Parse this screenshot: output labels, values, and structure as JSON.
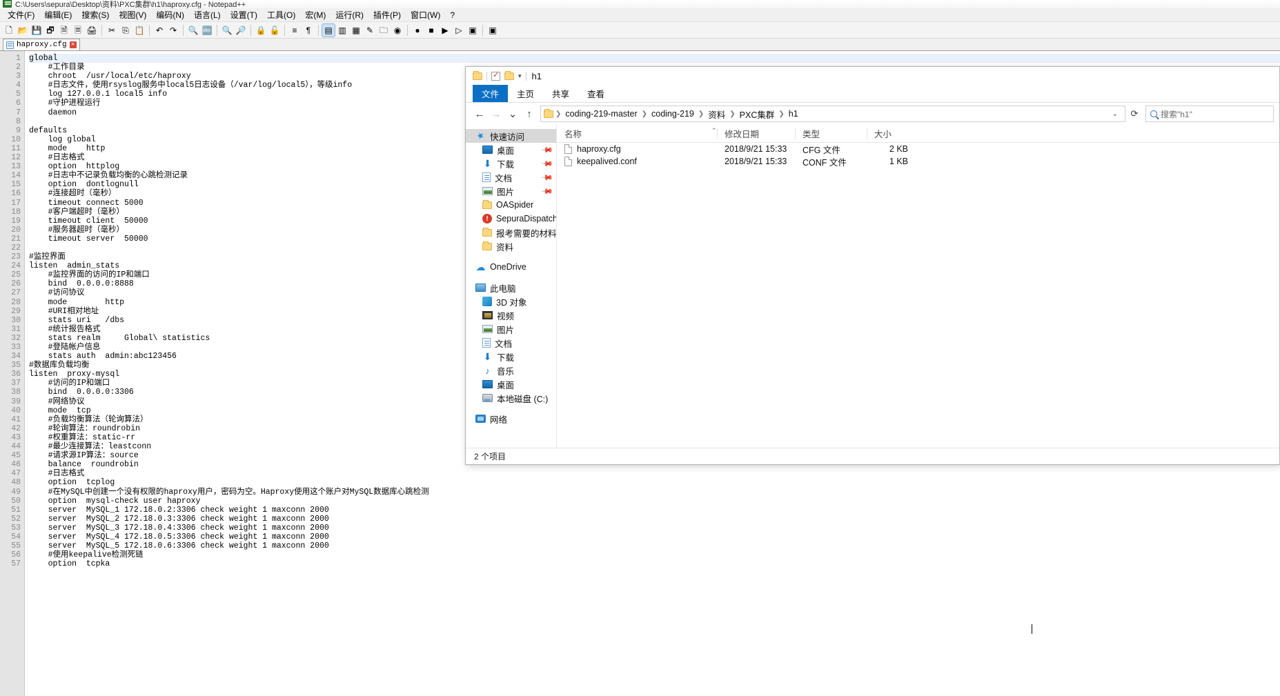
{
  "notepad": {
    "window_title": "C:\\Users\\sepura\\Desktop\\资料\\PXC集群\\h1\\haproxy.cfg - Notepad++",
    "menu": [
      "文件(F)",
      "编辑(E)",
      "搜索(S)",
      "视图(V)",
      "编码(N)",
      "语言(L)",
      "设置(T)",
      "工具(O)",
      "宏(M)",
      "运行(R)",
      "插件(P)",
      "窗口(W)",
      "?"
    ],
    "toolbar": [
      {
        "name": "new-file-icon",
        "glyph": "🗋"
      },
      {
        "name": "open-file-icon",
        "glyph": "📂"
      },
      {
        "name": "save-icon",
        "glyph": "💾"
      },
      {
        "name": "save-all-icon",
        "glyph": "🗗"
      },
      {
        "name": "close-file-icon",
        "glyph": "🗎"
      },
      {
        "name": "close-all-icon",
        "glyph": "🗏"
      },
      {
        "name": "print-icon",
        "glyph": "🖨"
      },
      {
        "name": "separator",
        "glyph": ""
      },
      {
        "name": "cut-icon",
        "glyph": "✂"
      },
      {
        "name": "copy-icon",
        "glyph": "⎘"
      },
      {
        "name": "paste-icon",
        "glyph": "📋"
      },
      {
        "name": "separator",
        "glyph": ""
      },
      {
        "name": "undo-icon",
        "glyph": "↶"
      },
      {
        "name": "redo-icon",
        "glyph": "↷"
      },
      {
        "name": "separator",
        "glyph": ""
      },
      {
        "name": "find-icon",
        "glyph": "🔍"
      },
      {
        "name": "replace-icon",
        "glyph": "🔤"
      },
      {
        "name": "separator",
        "glyph": ""
      },
      {
        "name": "zoom-in-icon",
        "glyph": "🔍"
      },
      {
        "name": "zoom-out-icon",
        "glyph": "🔎"
      },
      {
        "name": "separator",
        "glyph": ""
      },
      {
        "name": "sync-v-scroll-icon",
        "glyph": "🔒"
      },
      {
        "name": "sync-h-scroll-icon",
        "glyph": "🔓"
      },
      {
        "name": "separator",
        "glyph": ""
      },
      {
        "name": "word-wrap-icon",
        "glyph": "≡"
      },
      {
        "name": "show-all-chars-icon",
        "glyph": "¶"
      },
      {
        "name": "separator",
        "glyph": ""
      },
      {
        "name": "indent-guide-icon",
        "glyph": "▤"
      },
      {
        "name": "user-defined-dialog-icon",
        "glyph": "▥"
      },
      {
        "name": "doc-map-icon",
        "glyph": "▦"
      },
      {
        "name": "function-list-icon",
        "glyph": "✎"
      },
      {
        "name": "folder-workspace-icon",
        "glyph": "🗀"
      },
      {
        "name": "monitor-icon",
        "glyph": "◉"
      },
      {
        "name": "separator",
        "glyph": ""
      },
      {
        "name": "record-macro-icon",
        "glyph": "●"
      },
      {
        "name": "stop-macro-icon",
        "glyph": "■"
      },
      {
        "name": "playback-macro-icon",
        "glyph": "▶"
      },
      {
        "name": "run-macro-multiple-icon",
        "glyph": "▷"
      },
      {
        "name": "save-macro-icon",
        "glyph": "▣"
      },
      {
        "name": "separator",
        "glyph": ""
      },
      {
        "name": "run-icon",
        "glyph": "▣"
      }
    ],
    "tab": {
      "label": "haproxy.cfg",
      "close": "✕"
    },
    "code_lines": [
      "global",
      "    #工作目录",
      "    chroot  /usr/local/etc/haproxy",
      "    #日志文件，使用rsyslog服务中local5日志设备（/var/log/local5），等级info",
      "    log 127.0.0.1 local5 info",
      "    #守护进程运行",
      "    daemon",
      "",
      "defaults",
      "    log global",
      "    mode    http",
      "    #日志格式",
      "    option  httplog",
      "    #日志中不记录负载均衡的心跳检测记录",
      "    option  dontlognull",
      "    #连接超时（毫秒）",
      "    timeout connect 5000",
      "    #客户端超时（毫秒）",
      "    timeout client  50000",
      "    #服务器超时（毫秒）",
      "    timeout server  50000",
      "",
      "#监控界面",
      "listen  admin_stats",
      "    #监控界面的访问的IP和端口",
      "    bind  0.0.0.0:8888",
      "    #访问协议",
      "    mode        http",
      "    #URI相对地址",
      "    stats uri   /dbs",
      "    #统计报告格式",
      "    stats realm     Global\\ statistics",
      "    #登陆帐户信息",
      "    stats auth  admin:abc123456",
      "#数据库负载均衡",
      "listen  proxy-mysql",
      "    #访问的IP和端口",
      "    bind  0.0.0.0:3306",
      "    #网络协议",
      "    mode  tcp",
      "    #负载均衡算法（轮询算法）",
      "    #轮询算法：roundrobin",
      "    #权重算法：static-rr",
      "    #最少连接算法：leastconn",
      "    #请求源IP算法：source",
      "    balance  roundrobin",
      "    #日志格式",
      "    option  tcplog",
      "    #在MySQL中创建一个没有权限的haproxy用户，密码为空。Haproxy使用这个账户对MySQL数据库心跳检测",
      "    option  mysql-check user haproxy",
      "    server  MySQL_1 172.18.0.2:3306 check weight 1 maxconn 2000",
      "    server  MySQL_2 172.18.0.3:3306 check weight 1 maxconn 2000",
      "    server  MySQL_3 172.18.0.4:3306 check weight 1 maxconn 2000",
      "    server  MySQL_4 172.18.0.5:3306 check weight 1 maxconn 2000",
      "    server  MySQL_5 172.18.0.6:3306 check weight 1 maxconn 2000",
      "    #使用keepalive检测死链",
      "    option  tcpka"
    ]
  },
  "explorer": {
    "title": "h1",
    "ribbon_tabs": [
      "文件",
      "主页",
      "共享",
      "查看"
    ],
    "nav_buttons": {
      "back": "←",
      "forward": "→",
      "recent": "⌄",
      "up": "↑"
    },
    "breadcrumbs": [
      "coding-219-master",
      "coding-219",
      "资料",
      "PXC集群",
      "h1"
    ],
    "address_caret": "⌄",
    "refresh": "⟳",
    "search_placeholder": "搜索\"h1\"",
    "sidebar": [
      {
        "label": "快速访问",
        "icon": "quick-access-icon",
        "selected": true,
        "indent": 0,
        "pin": false
      },
      {
        "label": "桌面",
        "icon": "desktop-icon",
        "selected": false,
        "indent": 1,
        "pin": true
      },
      {
        "label": "下载",
        "icon": "downloads-icon",
        "selected": false,
        "indent": 1,
        "pin": true
      },
      {
        "label": "文档",
        "icon": "documents-icon",
        "selected": false,
        "indent": 1,
        "pin": true
      },
      {
        "label": "图片",
        "icon": "pictures-icon",
        "selected": false,
        "indent": 1,
        "pin": true
      },
      {
        "label": "OASpider",
        "icon": "folder-icon",
        "selected": false,
        "indent": 1,
        "pin": false
      },
      {
        "label": "SepuraDispatchPr",
        "icon": "app-icon",
        "selected": false,
        "indent": 1,
        "pin": false
      },
      {
        "label": "报考需要的材料",
        "icon": "folder-icon",
        "selected": false,
        "indent": 1,
        "pin": false
      },
      {
        "label": "资料",
        "icon": "folder-icon",
        "selected": false,
        "indent": 1,
        "pin": false
      },
      {
        "label": "OneDrive",
        "icon": "onedrive-icon",
        "selected": false,
        "indent": 0,
        "pin": false,
        "gap_before": true
      },
      {
        "label": "此电脑",
        "icon": "this-pc-icon",
        "selected": false,
        "indent": 0,
        "pin": false,
        "gap_before": true
      },
      {
        "label": "3D 对象",
        "icon": "3d-objects-icon",
        "selected": false,
        "indent": 1,
        "pin": false
      },
      {
        "label": "视频",
        "icon": "videos-icon",
        "selected": false,
        "indent": 1,
        "pin": false
      },
      {
        "label": "图片",
        "icon": "pictures-icon",
        "selected": false,
        "indent": 1,
        "pin": false
      },
      {
        "label": "文档",
        "icon": "documents-icon",
        "selected": false,
        "indent": 1,
        "pin": false
      },
      {
        "label": "下载",
        "icon": "downloads-icon",
        "selected": false,
        "indent": 1,
        "pin": false
      },
      {
        "label": "音乐",
        "icon": "music-icon",
        "selected": false,
        "indent": 1,
        "pin": false
      },
      {
        "label": "桌面",
        "icon": "desktop-icon",
        "selected": false,
        "indent": 1,
        "pin": false
      },
      {
        "label": "本地磁盘 (C:)",
        "icon": "local-disk-icon",
        "selected": false,
        "indent": 1,
        "pin": false
      },
      {
        "label": "网络",
        "icon": "network-icon",
        "selected": false,
        "indent": 0,
        "pin": false,
        "gap_before": true
      }
    ],
    "columns": [
      "名称",
      "修改日期",
      "类型",
      "大小"
    ],
    "files": [
      {
        "name": "haproxy.cfg",
        "date": "2018/9/21 15:33",
        "type": "CFG 文件",
        "size": "2 KB"
      },
      {
        "name": "keepalived.conf",
        "date": "2018/9/21 15:33",
        "type": "CONF 文件",
        "size": "1 KB"
      }
    ],
    "status": "2 个项目"
  },
  "colors": {
    "ribbon_active": "#0b6fc4",
    "gutter_bg": "#e4e4e4",
    "selection_line": "#e8f0fb"
  }
}
